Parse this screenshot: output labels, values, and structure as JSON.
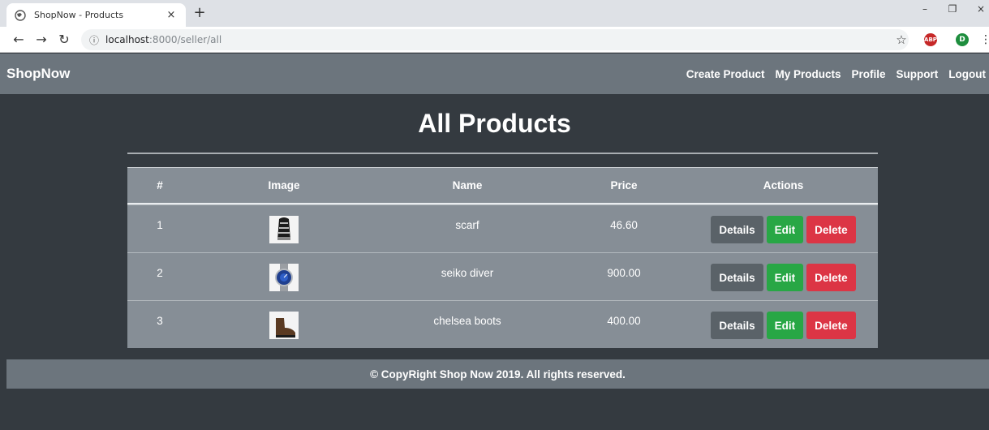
{
  "browser": {
    "tab_title": "ShopNow - Products",
    "tab_close": "×",
    "new_tab": "+",
    "url_host": "localhost",
    "url_path": ":8000/seller/all",
    "ext_abp": "ABP",
    "ext_profile": "D",
    "win_min": "–",
    "win_restore": "❐",
    "win_close": "×"
  },
  "navbar": {
    "brand": "ShopNow",
    "links": [
      {
        "label": "Create Product"
      },
      {
        "label": "My Products"
      },
      {
        "label": "Profile"
      },
      {
        "label": "Support"
      },
      {
        "label": "Logout"
      }
    ]
  },
  "page": {
    "title": "All Products"
  },
  "table": {
    "headers": [
      "#",
      "Image",
      "Name",
      "Price",
      "Actions"
    ],
    "rows": [
      {
        "num": "1",
        "image": "scarf-thumbnail",
        "name": "scarf",
        "price": "46.60"
      },
      {
        "num": "2",
        "image": "watch-thumbnail",
        "name": "seiko diver",
        "price": "900.00"
      },
      {
        "num": "3",
        "image": "boot-thumbnail",
        "name": "chelsea boots",
        "price": "400.00"
      }
    ],
    "actions": {
      "details": "Details",
      "edit": "Edit",
      "delete": "Delete"
    }
  },
  "footer": {
    "text": "© CopyRight Shop Now 2019. All rights reserved."
  },
  "colors": {
    "background": "#343a40",
    "navbar": "#6c757d",
    "table": "#868e96",
    "details": "#5a6268",
    "edit": "#28a745",
    "delete": "#dc3545"
  }
}
